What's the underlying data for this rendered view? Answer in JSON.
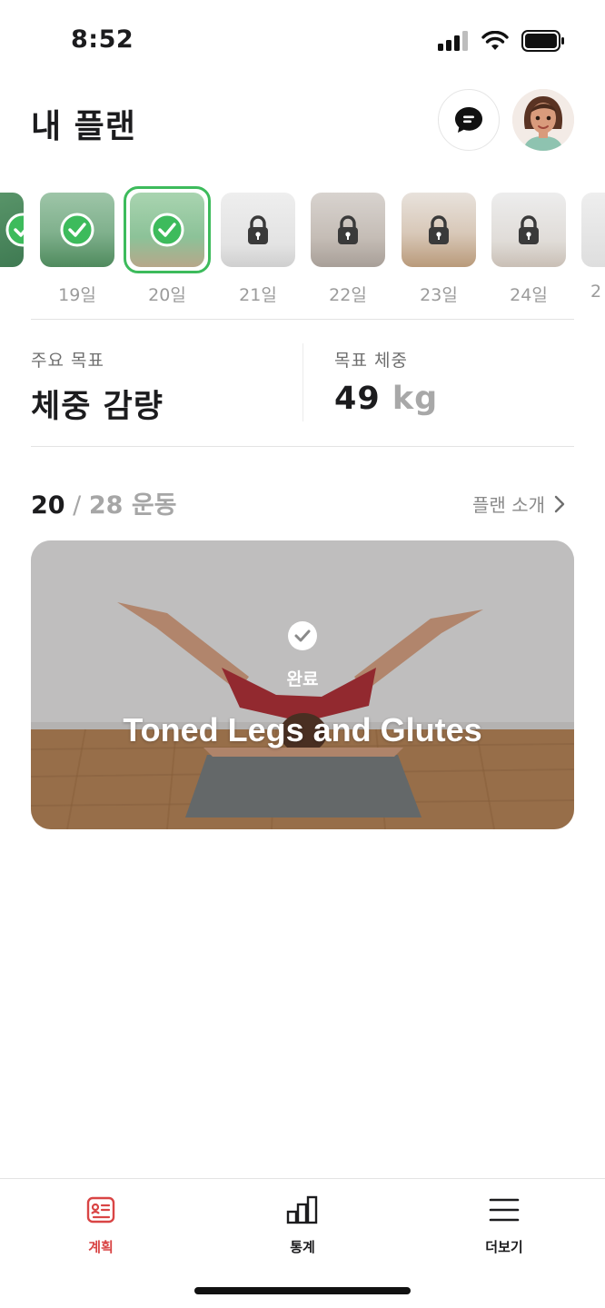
{
  "status_bar": {
    "time": "8:52",
    "icons": [
      "signal-icon",
      "wifi-icon",
      "battery-icon"
    ]
  },
  "header": {
    "title": "내 플랜",
    "chat_icon": "chat-bubble-icon",
    "avatar_icon": "avatar"
  },
  "days": [
    {
      "label": "",
      "state": "done"
    },
    {
      "label": "19일",
      "state": "done"
    },
    {
      "label": "20일",
      "state": "done",
      "selected": true
    },
    {
      "label": "21일",
      "state": "locked"
    },
    {
      "label": "22일",
      "state": "locked"
    },
    {
      "label": "23일",
      "state": "locked"
    },
    {
      "label": "24일",
      "state": "locked"
    },
    {
      "label": "2",
      "state": "locked"
    }
  ],
  "goals": {
    "main_goal_label": "주요 목표",
    "main_goal_value": "체중 감량",
    "target_weight_label": "목표 체중",
    "target_weight_value": "49",
    "target_weight_unit": "kg"
  },
  "progress": {
    "completed": "20",
    "separator": " / ",
    "total_text": "28 운동",
    "plan_intro_link": "플랜 소개"
  },
  "workout_card": {
    "status": "완료",
    "title": "Toned Legs and Glutes"
  },
  "bottom_nav": {
    "items": [
      {
        "label": "계획",
        "icon": "plan-icon",
        "active": true
      },
      {
        "label": "통계",
        "icon": "stats-icon",
        "active": false
      },
      {
        "label": "더보기",
        "icon": "menu-icon",
        "active": false
      }
    ]
  },
  "colors": {
    "accent_green": "#3dbb5c",
    "nav_active_red": "#d94545",
    "text_dark": "#1c1c1e",
    "text_muted": "#9b9b9b"
  }
}
